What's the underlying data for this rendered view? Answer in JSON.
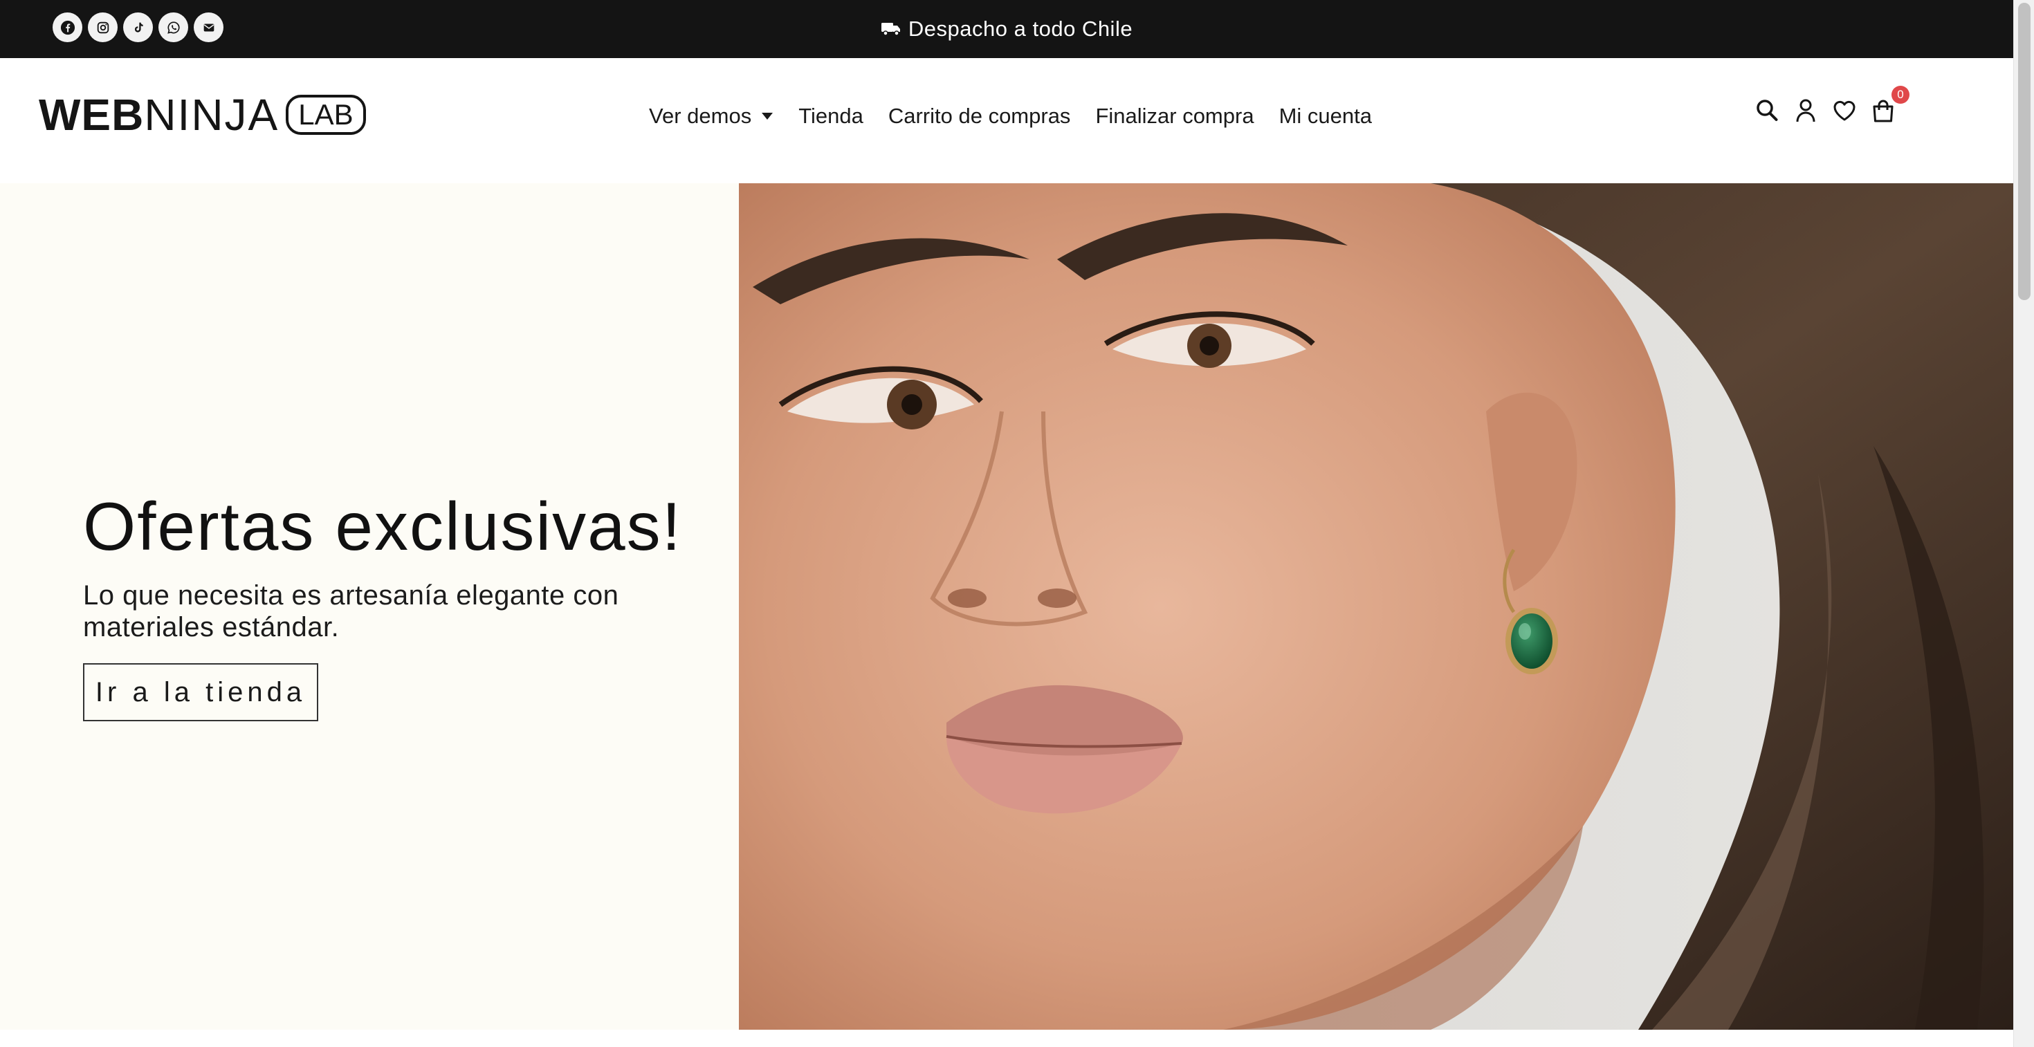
{
  "topbar": {
    "social": [
      {
        "name": "facebook-icon"
      },
      {
        "name": "instagram-icon"
      },
      {
        "name": "tiktok-icon"
      },
      {
        "name": "whatsapp-icon"
      },
      {
        "name": "email-icon"
      }
    ],
    "announcement_icon": "truck-icon",
    "announcement": "Despacho a todo Chile"
  },
  "header": {
    "logo": {
      "part1": "WEB",
      "part2": "NINJA",
      "badge": "LAB"
    },
    "nav": [
      {
        "label": "Ver demos",
        "has_dropdown": true
      },
      {
        "label": "Tienda"
      },
      {
        "label": "Carrito de compras"
      },
      {
        "label": "Finalizar compra"
      },
      {
        "label": "Mi cuenta"
      }
    ],
    "icons": [
      "search-icon",
      "account-icon",
      "wishlist-icon",
      "cart-icon"
    ],
    "cart_count": "0"
  },
  "hero": {
    "title": "Ofertas exclusivas!",
    "subtitle": "Lo que necesita es artesanía elegante con materiales estándar.",
    "button": "Ir a la tienda"
  },
  "colors": {
    "topbar_bg": "#141414",
    "hero_left_bg": "#fdfcf6",
    "badge": "#e0484a",
    "text": "#111111"
  }
}
